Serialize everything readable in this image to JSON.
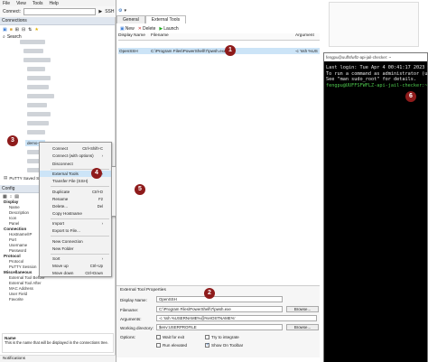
{
  "menubar": {
    "items": [
      "File",
      "View",
      "Tools",
      "Help"
    ]
  },
  "connect": {
    "label": "Connect:",
    "protocol": "SSH",
    "placeholder": ""
  },
  "left": {
    "connections_header": "Connections",
    "search_label": "Search",
    "putty_saved": "PuTTY Saved S",
    "config_header": "Config",
    "config": {
      "display_group": "Display",
      "display_items": [
        "Name",
        "Description",
        "Icon",
        "Panel"
      ],
      "connection_group": "Connection",
      "connection_items": [
        "Hostname/IP",
        "Port",
        "Username",
        "Password"
      ],
      "protocol_group": "Protocol",
      "protocol_items": [
        "Protocol",
        "PuTTY Session"
      ],
      "misc_group": "Miscellaneous",
      "misc_items": [
        "External Tool Before",
        "External Tool After",
        "MAC Address",
        "User Field",
        "Favorite"
      ]
    },
    "name_label": "Name",
    "name_desc": "This is the name that will be displayed in the connections tree.",
    "notifications": "Notifications"
  },
  "context_menu": {
    "items": [
      {
        "label": "Connect",
        "shortcut": "Ctrl+Shift+C"
      },
      {
        "label": "Connect (with options)",
        "shortcut": ""
      },
      {
        "label": "Disconnect",
        "shortcut": ""
      },
      {
        "label": "External Tools",
        "shortcut": ""
      },
      {
        "label": "Transfer File (SSH)",
        "shortcut": ""
      },
      {
        "label": "Duplicate",
        "shortcut": "Ctrl+D"
      },
      {
        "label": "Rename",
        "shortcut": "F2"
      },
      {
        "label": "Delete...",
        "shortcut": "Del"
      },
      {
        "label": "Copy Hostname",
        "shortcut": ""
      },
      {
        "label": "Import",
        "shortcut": ""
      },
      {
        "label": "Export to File...",
        "shortcut": ""
      },
      {
        "label": "New Connection",
        "shortcut": ""
      },
      {
        "label": "New Folder",
        "shortcut": ""
      },
      {
        "label": "Sort",
        "shortcut": ""
      },
      {
        "label": "Move up",
        "shortcut": "Ctrl+Up"
      },
      {
        "label": "Move down",
        "shortcut": "Ctrl+Down"
      }
    ],
    "selected_node": "demo-ser"
  },
  "submenu": {
    "items": [
      "OpenSSH"
    ]
  },
  "badges": [
    "1",
    "2",
    "3",
    "4",
    "5",
    "6"
  ],
  "right": {
    "tabs": [
      "General",
      "External Tools"
    ],
    "toolbar": [
      "New",
      "Delete",
      "Launch"
    ],
    "columns": [
      "Display Name",
      "Filename",
      "Argument"
    ],
    "rows": [
      {
        "name": "",
        "file": "",
        "arg": ""
      },
      {
        "name": "OpenSSH",
        "file": "C:\\Program Files\\PowerShell\\7\\pwsh.exe",
        "arg": "-c 'ssh %US"
      }
    ],
    "props_title": "External Tool Properties",
    "props": {
      "display_name_label": "Display Name:",
      "display_name": "OpenSSH",
      "filename_label": "Filename:",
      "filename": "C:\\Program Files\\PowerShell\\7\\pwsh.exe",
      "arguments_label": "Arguments:",
      "arguments": "-c 'ssh %USERNAME%@%HOSTNAME%'",
      "workdir_label": "Working directory:",
      "workdir": "$env:USERPROFILE",
      "options_label": "Options:",
      "browse": "Browse...",
      "wait_for_exit": "Wait for exit",
      "try_integrate": "Try to integrate",
      "run_elevated": "Run elevated",
      "show_on_toolbar": "Show On Toolbar"
    }
  },
  "terminal": {
    "title": "fengpu@uuffsfwflz-api-jail-checker: ~",
    "lines": [
      "Last login: Tue Apr  4 00:41:17 2023 fr",
      "To run a command as administrator (user",
      "See \"man sudo_root\" for details.",
      ""
    ],
    "prompt": "fengpu@UUFFSFWFLZ-api-jail-checker:~$"
  },
  "colors": {
    "badge": "#8e1b1b",
    "prompt": "#4ec94e",
    "accent": "#1a5fb4"
  }
}
